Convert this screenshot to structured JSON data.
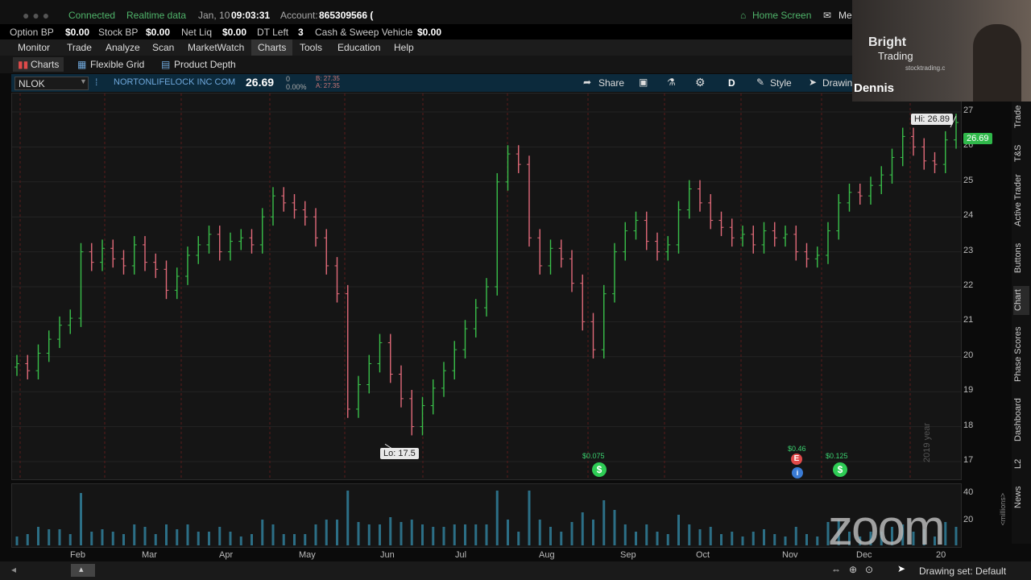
{
  "top": {
    "connection": "Connected",
    "data_mode": "Realtime data",
    "date": "Jan, 10",
    "time": "09:03:31",
    "account_label": "Account:",
    "account_number": "865309566 (",
    "home_screen": "Home Screen",
    "messages": "Me"
  },
  "account_bar": [
    {
      "label": "Option BP",
      "value": "$0.00"
    },
    {
      "label": "Stock BP",
      "value": "$0.00"
    },
    {
      "label": "Net Liq",
      "value": "$0.00"
    },
    {
      "label": "DT Left",
      "value": "3"
    },
    {
      "label": "Cash & Sweep Vehicle",
      "value": "$0.00"
    }
  ],
  "menu": [
    "Monitor",
    "Trade",
    "Analyze",
    "Scan",
    "MarketWatch",
    "Charts",
    "Tools",
    "Education",
    "Help"
  ],
  "menu_active": "Charts",
  "subtabs": [
    "Charts",
    "Flexible Grid",
    "Product Depth"
  ],
  "symbol": {
    "ticker": "NLOK",
    "name": "NORTONLIFELOCK INC COM",
    "price": "26.69",
    "change": "0",
    "change_pct": "0.00%",
    "bid": "B: 27.35",
    "ask": "A: 27.35",
    "share": "Share",
    "aggregation": "D",
    "style": "Style",
    "drawing": "Drawin"
  },
  "webcam": {
    "name": "Dennis",
    "logo_line1": "Bright",
    "logo_line2": "Trading",
    "logo_line3": "stocktrading.c"
  },
  "chart_data": {
    "type": "ohlc",
    "hi_label": "Hi: 26.89",
    "lo_label": "Lo: 17.5",
    "last_price": "26.69",
    "y_ticks": [
      "27",
      "26",
      "25",
      "24",
      "23",
      "22",
      "21",
      "20",
      "19",
      "18",
      "17"
    ],
    "ylim": [
      16.7,
      27.3
    ],
    "x_labels": [
      "Feb",
      "Mar",
      "Apr",
      "May",
      "Jun",
      "Jul",
      "Aug",
      "Sep",
      "Oct",
      "Nov",
      "Dec",
      "20"
    ],
    "year_label": "2019 year",
    "closes": [
      19.8,
      19.6,
      20.1,
      20.5,
      20.9,
      21.1,
      23.0,
      22.7,
      23.1,
      22.8,
      22.6,
      23.2,
      22.7,
      22.5,
      21.9,
      22.3,
      22.9,
      23.2,
      23.5,
      23.0,
      23.3,
      23.4,
      23.2,
      24.0,
      24.6,
      24.4,
      24.2,
      24.0,
      23.4,
      22.6,
      21.8,
      18.5,
      19.2,
      19.8,
      20.4,
      19.5,
      18.8,
      18.0,
      18.6,
      19.1,
      19.6,
      20.2,
      20.8,
      21.4,
      22.0,
      25.0,
      25.8,
      25.5,
      23.4,
      22.6,
      23.1,
      22.8,
      22.1,
      21.0,
      20.2,
      21.8,
      23.0,
      23.6,
      23.9,
      23.3,
      23.0,
      23.2,
      24.2,
      24.8,
      24.4,
      23.9,
      23.7,
      23.4,
      23.5,
      23.2,
      23.6,
      23.4,
      23.5,
      23.0,
      22.8,
      22.9,
      23.6,
      24.4,
      24.7,
      24.6,
      24.9,
      25.2,
      25.7,
      26.3,
      26.0,
      25.6,
      25.5,
      26.2,
      26.7
    ],
    "dividends": [
      "$0.075",
      "$0.46",
      "$0.125"
    ]
  },
  "volume": {
    "axis_top": "40",
    "axis_mid": "20",
    "unit": "<millions>"
  },
  "right_tabs": [
    "Trade",
    "T&S",
    "Active Trader",
    "Buttons",
    "Chart",
    "Phase Scores",
    "Dashboard",
    "L2",
    "News"
  ],
  "bottom": {
    "drawing_set": "Drawing set: Default"
  },
  "overlay": {
    "zoom": "zoom"
  },
  "colors": {
    "up": "#39c04a",
    "down": "#e26a7a",
    "accent": "#7ad0ff",
    "dividend": "#2ecc55"
  }
}
